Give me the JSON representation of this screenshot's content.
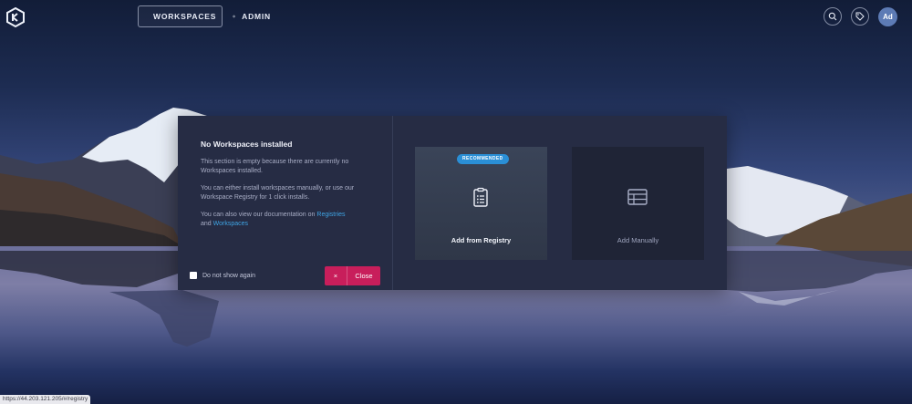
{
  "topbar": {
    "logo_icon": "logo-icon",
    "nav": [
      {
        "label": "WORKSPACES",
        "icon": "layers-icon",
        "active": true
      },
      {
        "label": "ADMIN",
        "icon": "gear-icon",
        "active": false
      }
    ],
    "actions": [
      {
        "icon": "search-icon"
      },
      {
        "icon": "tag-icon"
      }
    ],
    "avatar_initials": "Ad"
  },
  "dialog": {
    "title": "No Workspaces installed",
    "para1": "This section is empty because there are currently no Workspaces installed.",
    "para2": "You can either install workspaces manually, or use our Workspace Registry for 1 click installs.",
    "para3_prefix": "You can also view our documentation on ",
    "para3_link1": "Registries",
    "para3_and": "and ",
    "para3_link2": "Workspaces",
    "dont_show_label": "Do not show again",
    "close_icon": "×",
    "close_label": "Close",
    "cards": [
      {
        "label": "Add from Registry",
        "badge": "RECOMMENDED",
        "icon": "clipboard-list-icon"
      },
      {
        "label": "Add Manually",
        "icon": "table-icon"
      }
    ]
  },
  "statusbar": {
    "text": "https://44.203.121.205/#/registry"
  },
  "colors": {
    "accent": "#2a8fd6",
    "close": "#c81e5b",
    "link": "#3fa4e4",
    "dialog_bg": "#262c44"
  }
}
